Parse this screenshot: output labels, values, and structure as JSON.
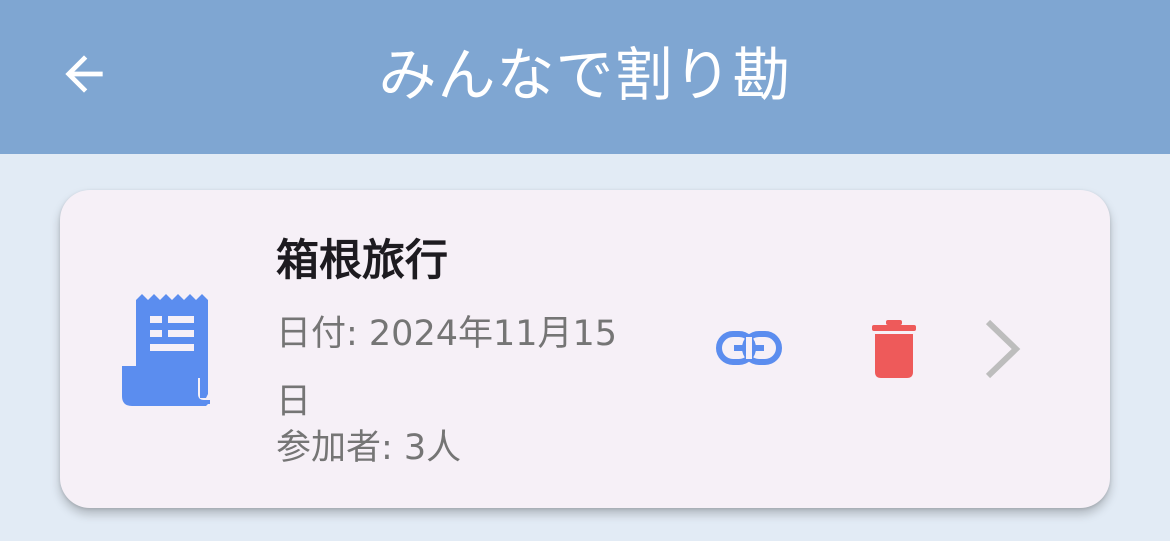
{
  "app_bar": {
    "title": "みんなで割り勘",
    "back_icon": "arrow-back-icon"
  },
  "event_card": {
    "title": "箱根旅行",
    "date_text": "日付: 2024年11月15日",
    "participants_text": "参加者: 3人",
    "icons": {
      "leading": "receipt-icon",
      "share": "link-icon",
      "delete": "trash-icon",
      "open": "chevron-right-icon"
    }
  },
  "colors": {
    "app_bar": "#7fa6d2",
    "background": "#e2ebf5",
    "card": "#f6f0f7",
    "accent_blue": "#5b8def",
    "delete_red": "#ee5a5a",
    "chevron_gray": "#bdbdbd"
  }
}
